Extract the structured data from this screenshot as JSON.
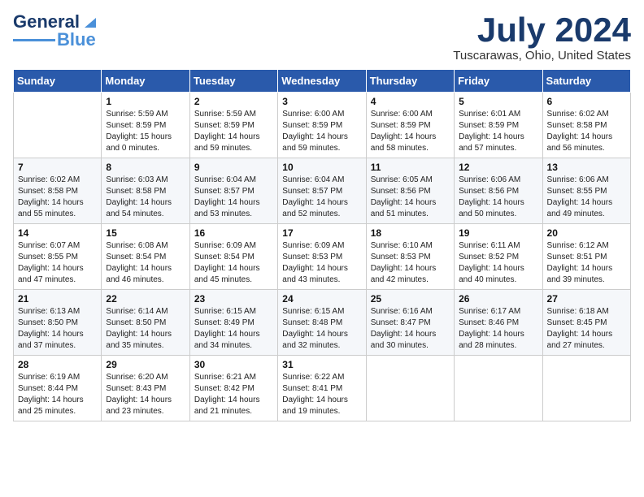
{
  "header": {
    "logo_general": "General",
    "logo_blue": "Blue",
    "month_title": "July 2024",
    "location": "Tuscarawas, Ohio, United States"
  },
  "calendar": {
    "days_of_week": [
      "Sunday",
      "Monday",
      "Tuesday",
      "Wednesday",
      "Thursday",
      "Friday",
      "Saturday"
    ],
    "weeks": [
      [
        {
          "day": "",
          "sunrise": "",
          "sunset": "",
          "daylight": ""
        },
        {
          "day": "1",
          "sunrise": "Sunrise: 5:59 AM",
          "sunset": "Sunset: 8:59 PM",
          "daylight": "Daylight: 15 hours and 0 minutes."
        },
        {
          "day": "2",
          "sunrise": "Sunrise: 5:59 AM",
          "sunset": "Sunset: 8:59 PM",
          "daylight": "Daylight: 14 hours and 59 minutes."
        },
        {
          "day": "3",
          "sunrise": "Sunrise: 6:00 AM",
          "sunset": "Sunset: 8:59 PM",
          "daylight": "Daylight: 14 hours and 59 minutes."
        },
        {
          "day": "4",
          "sunrise": "Sunrise: 6:00 AM",
          "sunset": "Sunset: 8:59 PM",
          "daylight": "Daylight: 14 hours and 58 minutes."
        },
        {
          "day": "5",
          "sunrise": "Sunrise: 6:01 AM",
          "sunset": "Sunset: 8:59 PM",
          "daylight": "Daylight: 14 hours and 57 minutes."
        },
        {
          "day": "6",
          "sunrise": "Sunrise: 6:02 AM",
          "sunset": "Sunset: 8:58 PM",
          "daylight": "Daylight: 14 hours and 56 minutes."
        }
      ],
      [
        {
          "day": "7",
          "sunrise": "Sunrise: 6:02 AM",
          "sunset": "Sunset: 8:58 PM",
          "daylight": "Daylight: 14 hours and 55 minutes."
        },
        {
          "day": "8",
          "sunrise": "Sunrise: 6:03 AM",
          "sunset": "Sunset: 8:58 PM",
          "daylight": "Daylight: 14 hours and 54 minutes."
        },
        {
          "day": "9",
          "sunrise": "Sunrise: 6:04 AM",
          "sunset": "Sunset: 8:57 PM",
          "daylight": "Daylight: 14 hours and 53 minutes."
        },
        {
          "day": "10",
          "sunrise": "Sunrise: 6:04 AM",
          "sunset": "Sunset: 8:57 PM",
          "daylight": "Daylight: 14 hours and 52 minutes."
        },
        {
          "day": "11",
          "sunrise": "Sunrise: 6:05 AM",
          "sunset": "Sunset: 8:56 PM",
          "daylight": "Daylight: 14 hours and 51 minutes."
        },
        {
          "day": "12",
          "sunrise": "Sunrise: 6:06 AM",
          "sunset": "Sunset: 8:56 PM",
          "daylight": "Daylight: 14 hours and 50 minutes."
        },
        {
          "day": "13",
          "sunrise": "Sunrise: 6:06 AM",
          "sunset": "Sunset: 8:55 PM",
          "daylight": "Daylight: 14 hours and 49 minutes."
        }
      ],
      [
        {
          "day": "14",
          "sunrise": "Sunrise: 6:07 AM",
          "sunset": "Sunset: 8:55 PM",
          "daylight": "Daylight: 14 hours and 47 minutes."
        },
        {
          "day": "15",
          "sunrise": "Sunrise: 6:08 AM",
          "sunset": "Sunset: 8:54 PM",
          "daylight": "Daylight: 14 hours and 46 minutes."
        },
        {
          "day": "16",
          "sunrise": "Sunrise: 6:09 AM",
          "sunset": "Sunset: 8:54 PM",
          "daylight": "Daylight: 14 hours and 45 minutes."
        },
        {
          "day": "17",
          "sunrise": "Sunrise: 6:09 AM",
          "sunset": "Sunset: 8:53 PM",
          "daylight": "Daylight: 14 hours and 43 minutes."
        },
        {
          "day": "18",
          "sunrise": "Sunrise: 6:10 AM",
          "sunset": "Sunset: 8:53 PM",
          "daylight": "Daylight: 14 hours and 42 minutes."
        },
        {
          "day": "19",
          "sunrise": "Sunrise: 6:11 AM",
          "sunset": "Sunset: 8:52 PM",
          "daylight": "Daylight: 14 hours and 40 minutes."
        },
        {
          "day": "20",
          "sunrise": "Sunrise: 6:12 AM",
          "sunset": "Sunset: 8:51 PM",
          "daylight": "Daylight: 14 hours and 39 minutes."
        }
      ],
      [
        {
          "day": "21",
          "sunrise": "Sunrise: 6:13 AM",
          "sunset": "Sunset: 8:50 PM",
          "daylight": "Daylight: 14 hours and 37 minutes."
        },
        {
          "day": "22",
          "sunrise": "Sunrise: 6:14 AM",
          "sunset": "Sunset: 8:50 PM",
          "daylight": "Daylight: 14 hours and 35 minutes."
        },
        {
          "day": "23",
          "sunrise": "Sunrise: 6:15 AM",
          "sunset": "Sunset: 8:49 PM",
          "daylight": "Daylight: 14 hours and 34 minutes."
        },
        {
          "day": "24",
          "sunrise": "Sunrise: 6:15 AM",
          "sunset": "Sunset: 8:48 PM",
          "daylight": "Daylight: 14 hours and 32 minutes."
        },
        {
          "day": "25",
          "sunrise": "Sunrise: 6:16 AM",
          "sunset": "Sunset: 8:47 PM",
          "daylight": "Daylight: 14 hours and 30 minutes."
        },
        {
          "day": "26",
          "sunrise": "Sunrise: 6:17 AM",
          "sunset": "Sunset: 8:46 PM",
          "daylight": "Daylight: 14 hours and 28 minutes."
        },
        {
          "day": "27",
          "sunrise": "Sunrise: 6:18 AM",
          "sunset": "Sunset: 8:45 PM",
          "daylight": "Daylight: 14 hours and 27 minutes."
        }
      ],
      [
        {
          "day": "28",
          "sunrise": "Sunrise: 6:19 AM",
          "sunset": "Sunset: 8:44 PM",
          "daylight": "Daylight: 14 hours and 25 minutes."
        },
        {
          "day": "29",
          "sunrise": "Sunrise: 6:20 AM",
          "sunset": "Sunset: 8:43 PM",
          "daylight": "Daylight: 14 hours and 23 minutes."
        },
        {
          "day": "30",
          "sunrise": "Sunrise: 6:21 AM",
          "sunset": "Sunset: 8:42 PM",
          "daylight": "Daylight: 14 hours and 21 minutes."
        },
        {
          "day": "31",
          "sunrise": "Sunrise: 6:22 AM",
          "sunset": "Sunset: 8:41 PM",
          "daylight": "Daylight: 14 hours and 19 minutes."
        },
        {
          "day": "",
          "sunrise": "",
          "sunset": "",
          "daylight": ""
        },
        {
          "day": "",
          "sunrise": "",
          "sunset": "",
          "daylight": ""
        },
        {
          "day": "",
          "sunrise": "",
          "sunset": "",
          "daylight": ""
        }
      ]
    ]
  }
}
